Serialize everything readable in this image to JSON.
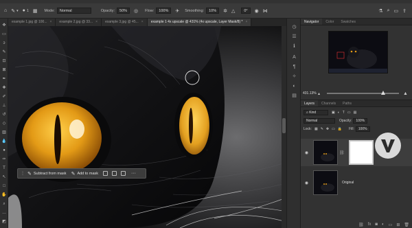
{
  "options_bar": {
    "mode_label": "Mode:",
    "mode_value": "Normal",
    "opacity_label": "Opacity:",
    "opacity_value": "50%",
    "flow_label": "Flow:",
    "flow_value": "100%",
    "smoothing_label": "Smoothing:",
    "smoothing_value": "10%",
    "angle_value": "0°"
  },
  "tabs": [
    {
      "label": "example 1.jpg @ 100...",
      "active": false
    },
    {
      "label": "example 2.jpg @ 33...",
      "active": false
    },
    {
      "label": "example 3.jpg @ 45...",
      "active": false
    },
    {
      "label": "example 1 4x upscale @ 431% (4x upscale, Layer Mask/8) *",
      "active": true
    }
  ],
  "taskbar": {
    "subtract_label": "Subtract from mask",
    "add_label": "Add to mask"
  },
  "navigator": {
    "tabs": [
      "Navigator",
      "Color",
      "Swatches"
    ],
    "zoom": "431.13%",
    "zoom_fraction": 0.78
  },
  "layers": {
    "tabs": [
      "Layers",
      "Channels",
      "Paths"
    ],
    "filter_value": "Kind",
    "blend_mode": "Normal",
    "opacity_label": "Opacity:",
    "opacity_value": "100%",
    "lock_label": "Lock:",
    "fill_label": "Fill:",
    "fill_value": "100%",
    "items": [
      {
        "name": "",
        "selected": true,
        "has_mask": true
      },
      {
        "name": "Original",
        "selected": false,
        "has_mask": false
      }
    ]
  },
  "colors": {
    "eye": "#e39a16",
    "ui_bg": "#323232"
  }
}
